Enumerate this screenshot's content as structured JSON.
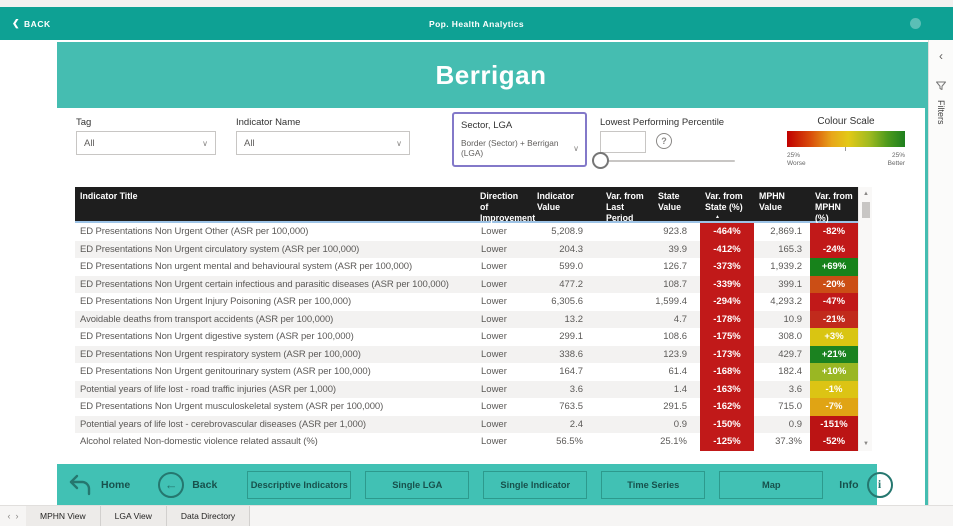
{
  "colors": {
    "topbar_teal": "#0EA194",
    "header_teal": "#45BDB1",
    "footer_teal": "#41C1B4",
    "table_header_bg": "#1E1E1E",
    "negative_red": "#C11919"
  },
  "app_bar": {
    "back_label": "BACK",
    "title": "Pop. Health Analytics"
  },
  "page_header": {
    "title": "Berrigan"
  },
  "filters": {
    "tag": {
      "label": "Tag",
      "value": "All"
    },
    "indicator_name": {
      "label": "Indicator Name",
      "value": "All"
    },
    "sector_lga": {
      "label": "Sector, LGA",
      "value": "Border (Sector) + Berrigan (LGA)"
    },
    "percentile": {
      "label": "Lowest Performing Percentile",
      "value": ""
    },
    "colour_scale": {
      "label": "Colour Scale",
      "worse_pct": "25%",
      "worse_text": "Worse",
      "better_pct": "25%",
      "better_text": "Better"
    }
  },
  "table": {
    "columns": [
      {
        "key": "indicator-title",
        "label": "Indicator Title"
      },
      {
        "key": "direction-of-improvement",
        "label": "Direction of Improvement"
      },
      {
        "key": "indicator-value",
        "label": "Indicator Value"
      },
      {
        "key": "var-from-last-period",
        "label": "Var. from Last Period"
      },
      {
        "key": "state-value",
        "label": "State Value"
      },
      {
        "key": "var-from-state",
        "label": "Var. from State (%)",
        "sorted": "asc"
      },
      {
        "key": "mphn-value",
        "label": "MPHN Value"
      },
      {
        "key": "var-from-mphn",
        "label": "Var. from MPHN (%)"
      }
    ],
    "rows": [
      {
        "title": "ED Presentations Non Urgent Other (ASR per 100,000)",
        "direction": "Lower",
        "indicator_value": "5,208.9",
        "var_last_period": "",
        "state_value": "923.8",
        "var_state": "-464%",
        "var_state_color": "#C11919",
        "mphn_value": "2,869.1",
        "var_mphn": "-82%",
        "var_mphn_color": "#C11919"
      },
      {
        "title": "ED Presentations Non Urgent circulatory system (ASR per 100,000)",
        "direction": "Lower",
        "indicator_value": "204.3",
        "var_last_period": "",
        "state_value": "39.9",
        "var_state": "-412%",
        "var_state_color": "#C11919",
        "mphn_value": "165.3",
        "var_mphn": "-24%",
        "var_mphn_color": "#C11919"
      },
      {
        "title": "ED Presentations Non urgent mental and behavioural system (ASR per 100,000)",
        "direction": "Lower",
        "indicator_value": "599.0",
        "var_last_period": "",
        "state_value": "126.7",
        "var_state": "-373%",
        "var_state_color": "#C11919",
        "mphn_value": "1,939.2",
        "var_mphn": "+69%",
        "var_mphn_color": "#17821B"
      },
      {
        "title": "ED Presentations Non Urgent certain infectious and parasitic diseases (ASR per 100,000)",
        "direction": "Lower",
        "indicator_value": "477.2",
        "var_last_period": "",
        "state_value": "108.7",
        "var_state": "-339%",
        "var_state_color": "#C11919",
        "mphn_value": "399.1",
        "var_mphn": "-20%",
        "var_mphn_color": "#CB4E15"
      },
      {
        "title": "ED Presentations Non Urgent Injury Poisoning (ASR per 100,000)",
        "direction": "Lower",
        "indicator_value": "6,305.6",
        "var_last_period": "",
        "state_value": "1,599.4",
        "var_state": "-294%",
        "var_state_color": "#C11919",
        "mphn_value": "4,293.2",
        "var_mphn": "-47%",
        "var_mphn_color": "#C11919"
      },
      {
        "title": "Avoidable deaths from transport accidents (ASR per 100,000)",
        "direction": "Lower",
        "indicator_value": "13.2",
        "var_last_period": "",
        "state_value": "4.7",
        "var_state": "-178%",
        "var_state_color": "#C11919",
        "mphn_value": "10.9",
        "var_mphn": "-21%",
        "var_mphn_color": "#C12A1C"
      },
      {
        "title": "ED Presentations Non Urgent digestive system (ASR per 100,000)",
        "direction": "Lower",
        "indicator_value": "299.1",
        "var_last_period": "",
        "state_value": "108.6",
        "var_state": "-175%",
        "var_state_color": "#C11919",
        "mphn_value": "308.0",
        "var_mphn": "+3%",
        "var_mphn_color": "#D9C512"
      },
      {
        "title": "ED Presentations Non Urgent respiratory system (ASR per 100,000)",
        "direction": "Lower",
        "indicator_value": "338.6",
        "var_last_period": "",
        "state_value": "123.9",
        "var_state": "-173%",
        "var_state_color": "#C11919",
        "mphn_value": "429.7",
        "var_mphn": "+21%",
        "var_mphn_color": "#1B8220"
      },
      {
        "title": "ED Presentations Non Urgent genitourinary system (ASR per 100,000)",
        "direction": "Lower",
        "indicator_value": "164.7",
        "var_last_period": "",
        "state_value": "61.4",
        "var_state": "-168%",
        "var_state_color": "#C11919",
        "mphn_value": "182.4",
        "var_mphn": "+10%",
        "var_mphn_color": "#9AB723"
      },
      {
        "title": "Potential years of life lost - road traffic injuries (ASR per 1,000)",
        "direction": "Lower",
        "indicator_value": "3.6",
        "var_last_period": "",
        "state_value": "1.4",
        "var_state": "-163%",
        "var_state_color": "#C11919",
        "mphn_value": "3.6",
        "var_mphn": "-1%",
        "var_mphn_color": "#DCC414"
      },
      {
        "title": "ED Presentations Non Urgent musculoskeletal system (ASR per 100,000)",
        "direction": "Lower",
        "indicator_value": "763.5",
        "var_last_period": "",
        "state_value": "291.5",
        "var_state": "-162%",
        "var_state_color": "#C11919",
        "mphn_value": "715.0",
        "var_mphn": "-7%",
        "var_mphn_color": "#E0A414"
      },
      {
        "title": "Potential years of life lost - cerebrovascular diseases (ASR per 1,000)",
        "direction": "Lower",
        "indicator_value": "2.4",
        "var_last_period": "",
        "state_value": "0.9",
        "var_state": "-150%",
        "var_state_color": "#C11919",
        "mphn_value": "0.9",
        "var_mphn": "-151%",
        "var_mphn_color": "#BB1414"
      },
      {
        "title": "Alcohol related Non-domestic violence related assault (%)",
        "direction": "Lower",
        "indicator_value": "56.5%",
        "var_last_period": "",
        "state_value": "25.1%",
        "var_state": "-125%",
        "var_state_color": "#C11919",
        "mphn_value": "37.3%",
        "var_mphn": "-52%",
        "var_mphn_color": "#BB1414"
      }
    ]
  },
  "footer_nav": {
    "home_label": "Home",
    "back_label": "Back",
    "buttons": [
      "Descriptive Indicators",
      "Single LGA",
      "Single Indicator",
      "Time Series",
      "Map"
    ],
    "info_label": "Info"
  },
  "page_tabs": {
    "tabs": [
      "MPHN View",
      "LGA View",
      "Data Directory"
    ]
  },
  "filters_rail": {
    "label": "Filters"
  }
}
